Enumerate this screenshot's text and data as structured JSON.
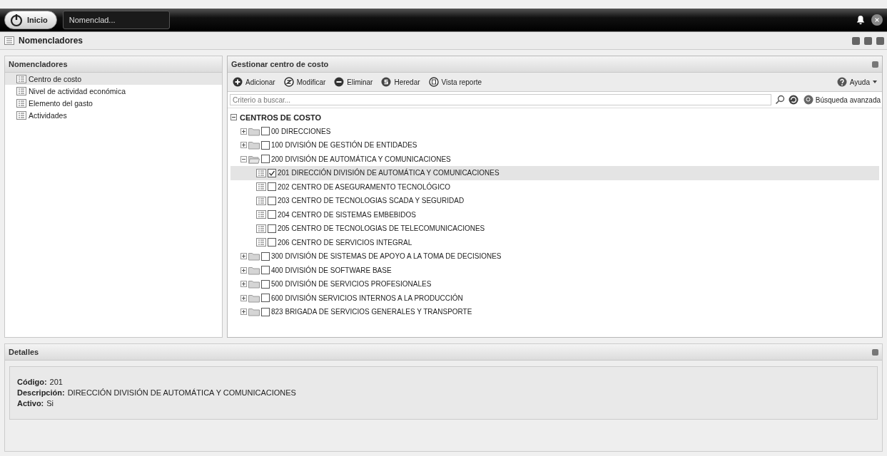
{
  "taskbar": {
    "start_label": "Inicio",
    "window_tab": "Nomenclad..."
  },
  "window": {
    "title": "Nomencladores"
  },
  "sidebar": {
    "title": "Nomencladores",
    "items": [
      {
        "label": "Centro de costo",
        "selected": true
      },
      {
        "label": "Nivel de actividad económica",
        "selected": false
      },
      {
        "label": "Elemento del gasto",
        "selected": false
      },
      {
        "label": "Actividades",
        "selected": false
      }
    ]
  },
  "main": {
    "title": "Gestionar centro de costo",
    "toolbar": [
      {
        "kind": "add",
        "label": "Adicionar"
      },
      {
        "kind": "edit",
        "label": "Modificar"
      },
      {
        "kind": "delete",
        "label": "Eliminar"
      },
      {
        "kind": "inherit",
        "label": "Heredar"
      },
      {
        "kind": "report",
        "label": "Vista reporte"
      }
    ],
    "help": "Ayuda",
    "search": {
      "placeholder": "Criterio a buscar..."
    },
    "advanced_search": "Búsqueda avanzada",
    "tree": {
      "label": "CENTROS DE COSTO",
      "expanded": true,
      "children": [
        {
          "kind": "folder",
          "label": "00 DIRECCIONES",
          "expanded": false,
          "checked": false,
          "selected": false
        },
        {
          "kind": "folder",
          "label": "100 DIVISIÓN DE GESTIÓN DE ENTIDADES",
          "expanded": false,
          "checked": false,
          "selected": false
        },
        {
          "kind": "folder",
          "label": "200 DIVISIÓN DE AUTOMÁTICA Y COMUNICACIONES",
          "expanded": true,
          "checked": false,
          "selected": false,
          "children": [
            {
              "kind": "leaf",
              "label": "201 DIRECCIÓN DIVISIÓN DE AUTOMÁTICA Y COMUNICACIONES",
              "checked": true,
              "selected": true
            },
            {
              "kind": "leaf",
              "label": "202 CENTRO DE ASEGURAMENTO TECNOLÓGICO",
              "checked": false,
              "selected": false
            },
            {
              "kind": "leaf",
              "label": "203 CENTRO DE TECNOLOGIAS SCADA Y SEGURIDAD",
              "checked": false,
              "selected": false
            },
            {
              "kind": "leaf",
              "label": "204 CENTRO DE SISTEMAS EMBEBIDOS",
              "checked": false,
              "selected": false
            },
            {
              "kind": "leaf",
              "label": "205 CENTRO DE TECNOLOGIAS DE TELECOMUNICACIONES",
              "checked": false,
              "selected": false
            },
            {
              "kind": "leaf",
              "label": "206 CENTRO DE SERVICIOS INTEGRAL",
              "checked": false,
              "selected": false
            }
          ]
        },
        {
          "kind": "folder",
          "label": "300 DIVISIÓN DE SISTEMAS DE APOYO A LA TOMA DE DECISIONES",
          "expanded": false,
          "checked": false,
          "selected": false
        },
        {
          "kind": "folder",
          "label": "400 DIVISIÓN DE SOFTWARE BASE",
          "expanded": false,
          "checked": false,
          "selected": false
        },
        {
          "kind": "folder",
          "label": "500 DIVISIÓN DE SERVICIOS PROFESIONALES",
          "expanded": false,
          "checked": false,
          "selected": false
        },
        {
          "kind": "folder",
          "label": "600 DIVISIÓN SERVICIOS INTERNOS A LA PRODUCCIÓN",
          "expanded": false,
          "checked": false,
          "selected": false
        },
        {
          "kind": "folder",
          "label": "823 BRIGADA DE SERVICIOS GENERALES Y TRANSPORTE",
          "expanded": false,
          "checked": false,
          "selected": false
        }
      ]
    }
  },
  "details": {
    "title": "Detalles",
    "fields": [
      {
        "label": "Código:",
        "value": "201"
      },
      {
        "label": "Descripción:",
        "value": "DIRECCIÓN DIVISIÓN DE AUTOMÁTICA Y COMUNICACIONES"
      },
      {
        "label": "Activo:",
        "value": "Si"
      }
    ]
  }
}
